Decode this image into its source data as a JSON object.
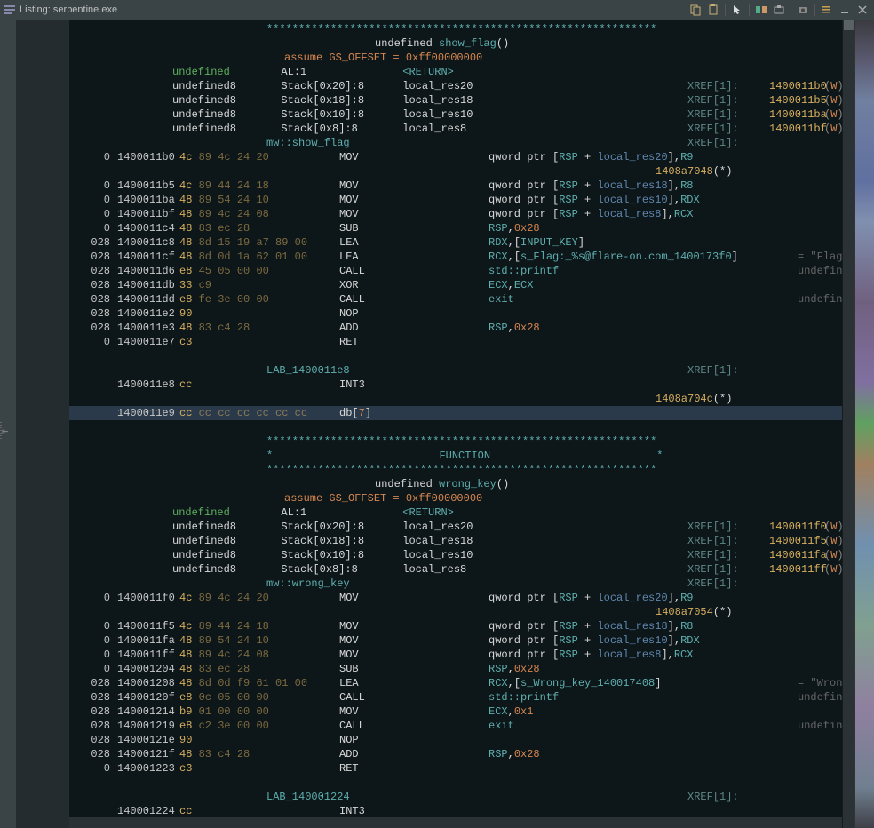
{
  "title": "Listing: serpentine.exe",
  "toolbar_icons": [
    "copy-icon",
    "paste-icon",
    "cursor-icon",
    "diff-icon",
    "snapshot-icon",
    "camera-icon",
    "list-icon",
    "minimize-icon",
    "close-icon"
  ],
  "separator": "****************************************************************",
  "function_label": "FUNCTION",
  "func1": {
    "sig_type": "undefined",
    "sig_name": "show_flag",
    "assume": "assume GS_OFFSET = 0xff00000000",
    "ret": {
      "type": "undefined",
      "reg": "AL:1",
      "label": "<RETURN>"
    },
    "params": [
      {
        "type": "undefined8",
        "loc": "Stack[0x20]:8",
        "name": "local_res20",
        "xref": "XREF[1]:",
        "xaddr": "1400011b0",
        "rw": "(W)"
      },
      {
        "type": "undefined8",
        "loc": "Stack[0x18]:8",
        "name": "local_res18",
        "xref": "XREF[1]:",
        "xaddr": "1400011b5",
        "rw": "(W)"
      },
      {
        "type": "undefined8",
        "loc": "Stack[0x10]:8",
        "name": "local_res10",
        "xref": "XREF[1]:",
        "xaddr": "1400011ba",
        "rw": "(W)"
      },
      {
        "type": "undefined8",
        "loc": "Stack[0x8]:8",
        "name": "local_res8",
        "xref": "XREF[1]:",
        "xaddr": "1400011bf",
        "rw": "(W)"
      }
    ],
    "ns": "mw::show_flag",
    "ns_xref": "XREF[1]:",
    "rows": [
      {
        "off": "0",
        "addr": "1400011b0",
        "bytes": "4c 89 4c 24 20",
        "mnem": "MOV",
        "ops": [
          {
            "t": "qword ptr ",
            "c": "white"
          },
          {
            "t": "[",
            "c": "white"
          },
          {
            "t": "RSP",
            "c": "cyan"
          },
          {
            "t": " + ",
            "c": "white"
          },
          {
            "t": "local_res20",
            "c": "blue"
          },
          {
            "t": "],",
            "c": "white"
          },
          {
            "t": "R9",
            "c": "cyan"
          }
        ]
      },
      {
        "off": "",
        "addr": "",
        "bytes": "",
        "mnem": "",
        "ops": [],
        "tail": {
          "addr": "1408a7048",
          "suf": "(*)",
          "indent": 660
        }
      },
      {
        "off": "0",
        "addr": "1400011b5",
        "bytes": "4c 89 44 24 18",
        "mnem": "MOV",
        "ops": [
          {
            "t": "qword ptr ",
            "c": "white"
          },
          {
            "t": "[",
            "c": "white"
          },
          {
            "t": "RSP",
            "c": "cyan"
          },
          {
            "t": " + ",
            "c": "white"
          },
          {
            "t": "local_res18",
            "c": "blue"
          },
          {
            "t": "],",
            "c": "white"
          },
          {
            "t": "R8",
            "c": "cyan"
          }
        ]
      },
      {
        "off": "0",
        "addr": "1400011ba",
        "bytes": "48 89 54 24 10",
        "mnem": "MOV",
        "ops": [
          {
            "t": "qword ptr ",
            "c": "white"
          },
          {
            "t": "[",
            "c": "white"
          },
          {
            "t": "RSP",
            "c": "cyan"
          },
          {
            "t": " + ",
            "c": "white"
          },
          {
            "t": "local_res10",
            "c": "blue"
          },
          {
            "t": "],",
            "c": "white"
          },
          {
            "t": "RDX",
            "c": "cyan"
          }
        ]
      },
      {
        "off": "0",
        "addr": "1400011bf",
        "bytes": "48 89 4c 24 08",
        "mnem": "MOV",
        "ops": [
          {
            "t": "qword ptr ",
            "c": "white"
          },
          {
            "t": "[",
            "c": "white"
          },
          {
            "t": "RSP",
            "c": "cyan"
          },
          {
            "t": " + ",
            "c": "white"
          },
          {
            "t": "local_res8",
            "c": "blue"
          },
          {
            "t": "],",
            "c": "white"
          },
          {
            "t": "RCX",
            "c": "cyan"
          }
        ]
      },
      {
        "off": "0",
        "addr": "1400011c4",
        "bytes": "48 83 ec 28",
        "mnem": "SUB",
        "ops": [
          {
            "t": "RSP",
            "c": "cyan"
          },
          {
            "t": ",",
            "c": "white"
          },
          {
            "t": "0x28",
            "c": "orange"
          }
        ]
      },
      {
        "off": "028",
        "addr": "1400011c8",
        "bytes": "48 8d 15 19 a7 89 00",
        "mnem": "LEA",
        "ops": [
          {
            "t": "RDX",
            "c": "cyan"
          },
          {
            "t": ",[",
            "c": "white"
          },
          {
            "t": "INPUT_KEY",
            "c": "cyan"
          },
          {
            "t": "]",
            "c": "white"
          }
        ]
      },
      {
        "off": "028",
        "addr": "1400011cf",
        "bytes": "48 8d 0d 1a 62 01 00",
        "mnem": "LEA",
        "ops": [
          {
            "t": "RCX",
            "c": "cyan"
          },
          {
            "t": ",[",
            "c": "white"
          },
          {
            "t": "s_Flag:_%s@flare-on.com_1400173f0",
            "c": "cyan"
          },
          {
            "t": "]",
            "c": "white"
          }
        ],
        "comment": "= \"Flag:"
      },
      {
        "off": "028",
        "addr": "1400011d6",
        "bytes": "e8 45 05 00 00",
        "mnem": "CALL",
        "ops": [
          {
            "t": "std::printf",
            "c": "cyan"
          }
        ],
        "comment": "undefine"
      },
      {
        "off": "028",
        "addr": "1400011db",
        "bytes": "33 c9",
        "mnem": "XOR",
        "ops": [
          {
            "t": "ECX",
            "c": "cyan"
          },
          {
            "t": ",",
            "c": "white"
          },
          {
            "t": "ECX",
            "c": "cyan"
          }
        ]
      },
      {
        "off": "028",
        "addr": "1400011dd",
        "bytes": "e8 fe 3e 00 00",
        "mnem": "CALL",
        "ops": [
          {
            "t": "exit",
            "c": "cyan"
          }
        ],
        "comment": "undefine"
      },
      {
        "off": "028",
        "addr": "1400011e2",
        "bytes": "90",
        "mnem": "NOP",
        "ops": []
      },
      {
        "off": "028",
        "addr": "1400011e3",
        "bytes": "48 83 c4 28",
        "mnem": "ADD",
        "ops": [
          {
            "t": "RSP",
            "c": "cyan"
          },
          {
            "t": ",",
            "c": "white"
          },
          {
            "t": "0x28",
            "c": "orange"
          }
        ]
      },
      {
        "off": "0",
        "addr": "1400011e7",
        "bytes": "c3",
        "mnem": "RET",
        "ops": []
      }
    ],
    "label1": {
      "name": "LAB_1400011e8",
      "xref": "XREF[1]:"
    },
    "int3_1": {
      "addr": "1400011e8",
      "bytes": "cc",
      "mnem": "INT3"
    },
    "tail2": {
      "addr": "1408a704c",
      "suf": "(*)",
      "indent": 660
    },
    "db7": {
      "addr": "1400011e9",
      "bytes": "cc cc cc cc cc cc cc",
      "text": "db[7]"
    }
  },
  "func2": {
    "sig_type": "undefined",
    "sig_name": "wrong_key",
    "assume": "assume GS_OFFSET = 0xff00000000",
    "ret": {
      "type": "undefined",
      "reg": "AL:1",
      "label": "<RETURN>"
    },
    "params": [
      {
        "type": "undefined8",
        "loc": "Stack[0x20]:8",
        "name": "local_res20",
        "xref": "XREF[1]:",
        "xaddr": "1400011f0",
        "rw": "(W)"
      },
      {
        "type": "undefined8",
        "loc": "Stack[0x18]:8",
        "name": "local_res18",
        "xref": "XREF[1]:",
        "xaddr": "1400011f5",
        "rw": "(W)"
      },
      {
        "type": "undefined8",
        "loc": "Stack[0x10]:8",
        "name": "local_res10",
        "xref": "XREF[1]:",
        "xaddr": "1400011fa",
        "rw": "(W)"
      },
      {
        "type": "undefined8",
        "loc": "Stack[0x8]:8",
        "name": "local_res8",
        "xref": "XREF[1]:",
        "xaddr": "1400011ff",
        "rw": "(W)"
      }
    ],
    "ns": "mw::wrong_key",
    "ns_xref": "XREF[1]:",
    "rows": [
      {
        "off": "0",
        "addr": "1400011f0",
        "bytes": "4c 89 4c 24 20",
        "mnem": "MOV",
        "ops": [
          {
            "t": "qword ptr ",
            "c": "white"
          },
          {
            "t": "[",
            "c": "white"
          },
          {
            "t": "RSP",
            "c": "cyan"
          },
          {
            "t": " + ",
            "c": "white"
          },
          {
            "t": "local_res20",
            "c": "blue"
          },
          {
            "t": "],",
            "c": "white"
          },
          {
            "t": "R9",
            "c": "cyan"
          }
        ]
      },
      {
        "off": "",
        "addr": "",
        "bytes": "",
        "mnem": "",
        "ops": [],
        "tail": {
          "addr": "1408a7054",
          "suf": "(*)",
          "indent": 660
        }
      },
      {
        "off": "0",
        "addr": "1400011f5",
        "bytes": "4c 89 44 24 18",
        "mnem": "MOV",
        "ops": [
          {
            "t": "qword ptr ",
            "c": "white"
          },
          {
            "t": "[",
            "c": "white"
          },
          {
            "t": "RSP",
            "c": "cyan"
          },
          {
            "t": " + ",
            "c": "white"
          },
          {
            "t": "local_res18",
            "c": "blue"
          },
          {
            "t": "],",
            "c": "white"
          },
          {
            "t": "R8",
            "c": "cyan"
          }
        ]
      },
      {
        "off": "0",
        "addr": "1400011fa",
        "bytes": "48 89 54 24 10",
        "mnem": "MOV",
        "ops": [
          {
            "t": "qword ptr ",
            "c": "white"
          },
          {
            "t": "[",
            "c": "white"
          },
          {
            "t": "RSP",
            "c": "cyan"
          },
          {
            "t": " + ",
            "c": "white"
          },
          {
            "t": "local_res10",
            "c": "blue"
          },
          {
            "t": "],",
            "c": "white"
          },
          {
            "t": "RDX",
            "c": "cyan"
          }
        ]
      },
      {
        "off": "0",
        "addr": "1400011ff",
        "bytes": "48 89 4c 24 08",
        "mnem": "MOV",
        "ops": [
          {
            "t": "qword ptr ",
            "c": "white"
          },
          {
            "t": "[",
            "c": "white"
          },
          {
            "t": "RSP",
            "c": "cyan"
          },
          {
            "t": " + ",
            "c": "white"
          },
          {
            "t": "local_res8",
            "c": "blue"
          },
          {
            "t": "],",
            "c": "white"
          },
          {
            "t": "RCX",
            "c": "cyan"
          }
        ]
      },
      {
        "off": "0",
        "addr": "140001204",
        "bytes": "48 83 ec 28",
        "mnem": "SUB",
        "ops": [
          {
            "t": "RSP",
            "c": "cyan"
          },
          {
            "t": ",",
            "c": "white"
          },
          {
            "t": "0x28",
            "c": "orange"
          }
        ]
      },
      {
        "off": "028",
        "addr": "140001208",
        "bytes": "48 8d 0d f9 61 01 00",
        "mnem": "LEA",
        "ops": [
          {
            "t": "RCX",
            "c": "cyan"
          },
          {
            "t": ",[",
            "c": "white"
          },
          {
            "t": "s_Wrong_key_140017408",
            "c": "cyan"
          },
          {
            "t": "]",
            "c": "white"
          }
        ],
        "comment": "= \"Wrong"
      },
      {
        "off": "028",
        "addr": "14000120f",
        "bytes": "e8 0c 05 00 00",
        "mnem": "CALL",
        "ops": [
          {
            "t": "std::printf",
            "c": "cyan"
          }
        ],
        "comment": "undefine"
      },
      {
        "off": "028",
        "addr": "140001214",
        "bytes": "b9 01 00 00 00",
        "mnem": "MOV",
        "ops": [
          {
            "t": "ECX",
            "c": "cyan"
          },
          {
            "t": ",",
            "c": "white"
          },
          {
            "t": "0x1",
            "c": "orange"
          }
        ]
      },
      {
        "off": "028",
        "addr": "140001219",
        "bytes": "e8 c2 3e 00 00",
        "mnem": "CALL",
        "ops": [
          {
            "t": "exit",
            "c": "cyan"
          }
        ],
        "comment": "undefine"
      },
      {
        "off": "028",
        "addr": "14000121e",
        "bytes": "90",
        "mnem": "NOP",
        "ops": []
      },
      {
        "off": "028",
        "addr": "14000121f",
        "bytes": "48 83 c4 28",
        "mnem": "ADD",
        "ops": [
          {
            "t": "RSP",
            "c": "cyan"
          },
          {
            "t": ",",
            "c": "white"
          },
          {
            "t": "0x28",
            "c": "orange"
          }
        ]
      },
      {
        "off": "0",
        "addr": "140001223",
        "bytes": "c3",
        "mnem": "RET",
        "ops": []
      }
    ],
    "label1": {
      "name": "LAB_140001224",
      "xref": "XREF[1]:"
    },
    "int3_1": {
      "addr": "140001224",
      "bytes": "cc",
      "mnem": "INT3"
    }
  }
}
